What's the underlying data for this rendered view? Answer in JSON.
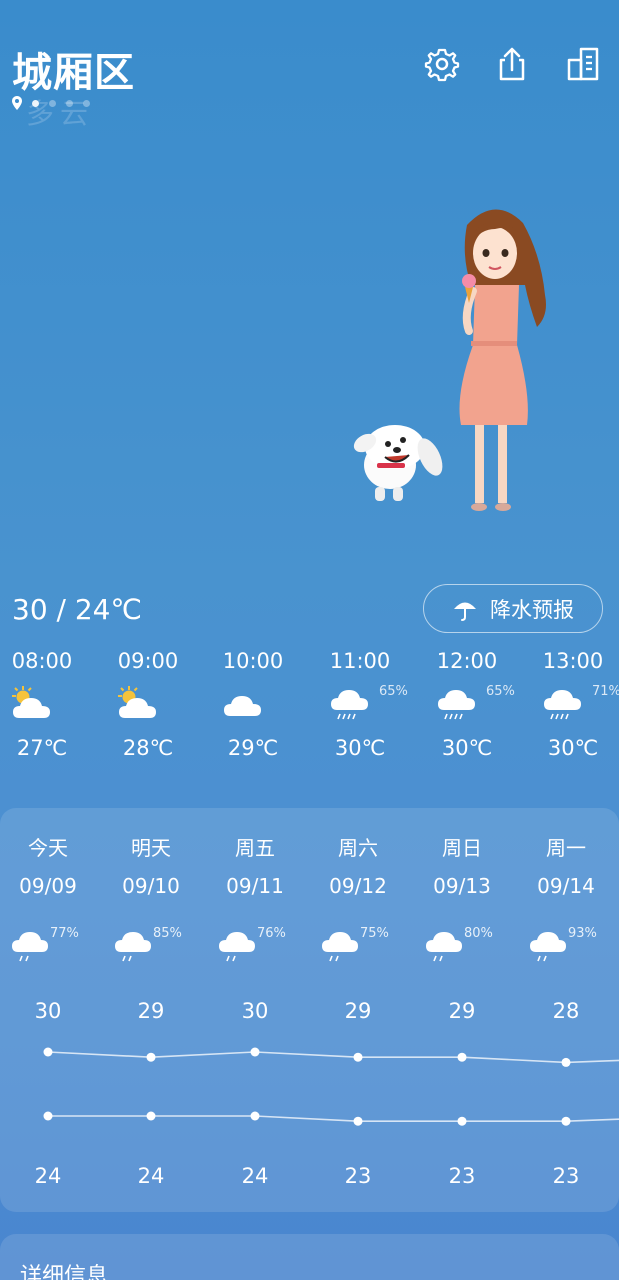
{
  "header": {
    "city": "城厢区",
    "faded_sub": "多云",
    "page_count": 4,
    "active_page": 0
  },
  "illustration": {
    "description_icon": "girl-and-dog-illustration-icon"
  },
  "today": {
    "temp_range": "30 / 24℃",
    "rain_button_label": "降水预报"
  },
  "hourly": [
    {
      "time": "08:00",
      "icon": "partly-sunny-icon",
      "pct": "",
      "temp": "27℃"
    },
    {
      "time": "09:00",
      "icon": "partly-sunny-icon",
      "pct": "",
      "temp": "28℃"
    },
    {
      "time": "10:00",
      "icon": "cloudy-icon",
      "pct": "",
      "temp": "29℃"
    },
    {
      "time": "11:00",
      "icon": "rain-icon",
      "pct": "65%",
      "temp": "30℃"
    },
    {
      "time": "12:00",
      "icon": "rain-icon",
      "pct": "65%",
      "temp": "30℃"
    },
    {
      "time": "13:00",
      "icon": "rain-icon",
      "pct": "71%",
      "temp": "30℃"
    }
  ],
  "daily": [
    {
      "name": "今天",
      "date": "09/09",
      "pct": "77%",
      "hi": "30",
      "lo": "24"
    },
    {
      "name": "明天",
      "date": "09/10",
      "pct": "85%",
      "hi": "29",
      "lo": "24"
    },
    {
      "name": "周五",
      "date": "09/11",
      "pct": "76%",
      "hi": "30",
      "lo": "24"
    },
    {
      "name": "周六",
      "date": "09/12",
      "pct": "75%",
      "hi": "29",
      "lo": "23"
    },
    {
      "name": "周日",
      "date": "09/13",
      "pct": "80%",
      "hi": "29",
      "lo": "23"
    },
    {
      "name": "周一",
      "date": "09/14",
      "pct": "93%",
      "hi": "28",
      "lo": "23"
    }
  ],
  "detail": {
    "title": "详细信息"
  },
  "colors": {
    "bg_top": "#3a8ccc",
    "bg_bottom": "#4a86cf",
    "sun": "#f5c33b",
    "cloud": "#ffffff"
  }
}
